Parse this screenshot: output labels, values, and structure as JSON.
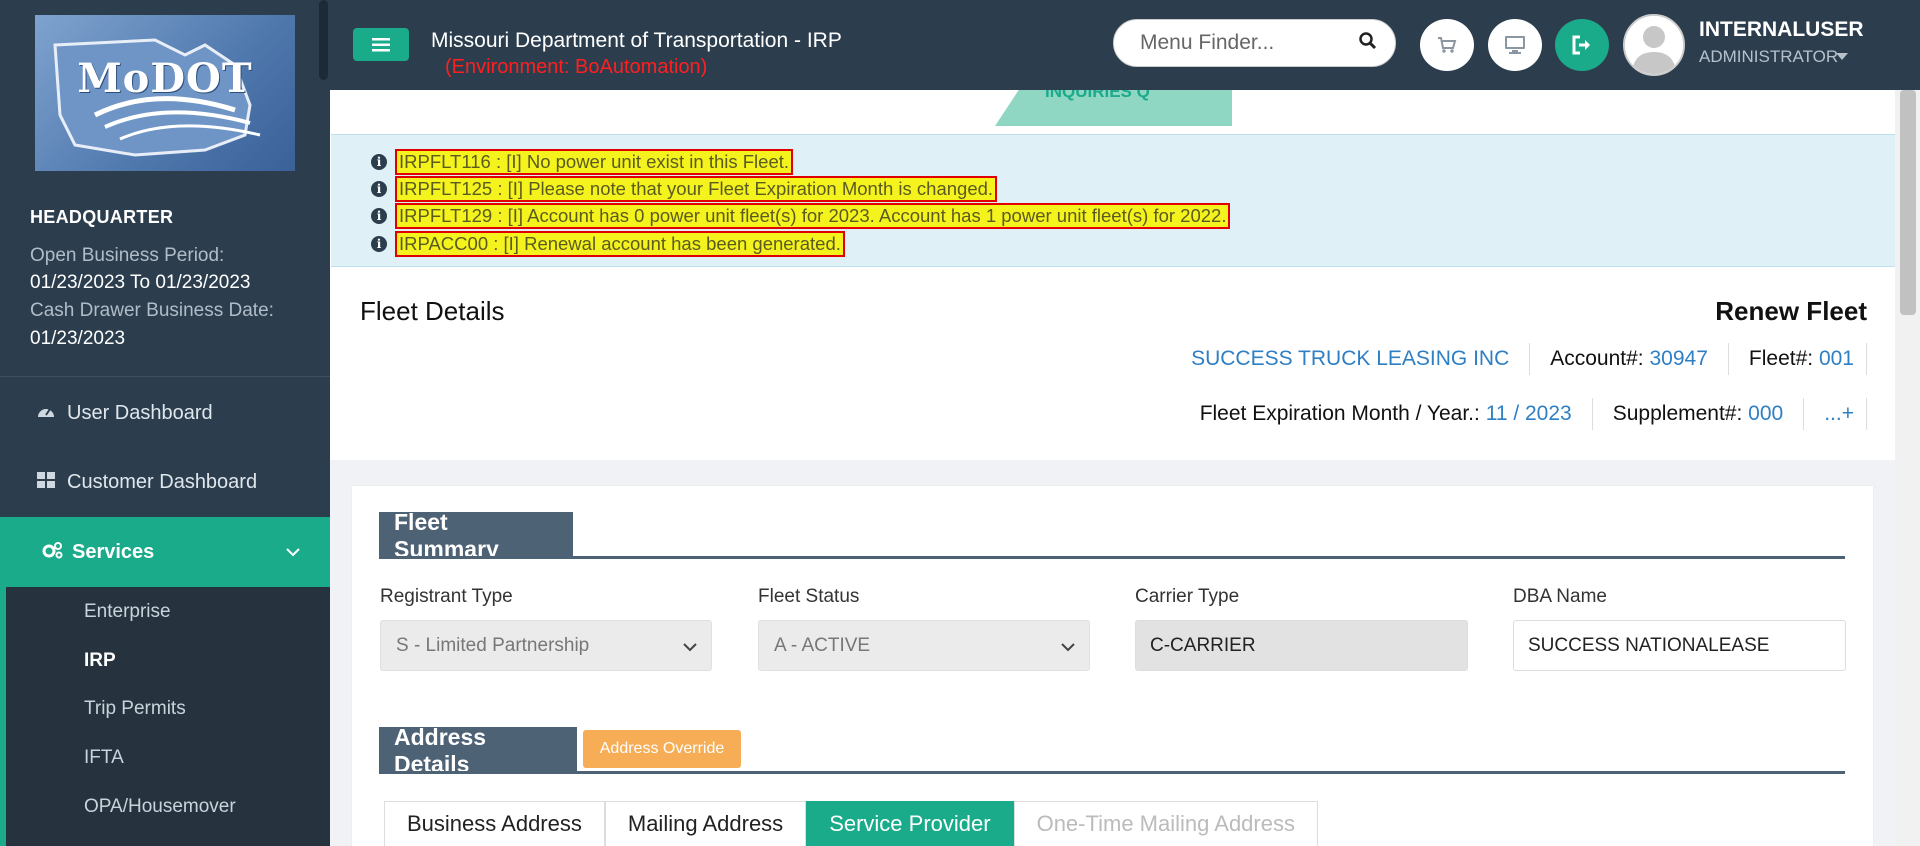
{
  "sidebar": {
    "logo_text": "MoDOT",
    "office": "HEADQUARTER",
    "open_business_period_label": "Open Business Period:",
    "open_business_period_value": "01/23/2023 To 01/23/2023",
    "cash_drawer_label": "Cash Drawer Business Date:",
    "cash_drawer_value": "01/23/2023",
    "nav": [
      {
        "label": "User Dashboard",
        "icon": "dashboard-icon"
      },
      {
        "label": "Customer Dashboard",
        "icon": "grid-icon"
      },
      {
        "label": "Services",
        "icon": "gears-icon",
        "active": true
      }
    ],
    "sub_items": [
      "Enterprise",
      "IRP",
      "Trip Permits",
      "IFTA",
      "OPA/Housemover"
    ],
    "current_sub_item": "IRP"
  },
  "header": {
    "title": "Missouri Department of Transportation - IRP",
    "environment": "(Environment: BoAutomation)",
    "menu_finder_placeholder": "Menu Finder...",
    "user_name": "INTERNALUSER",
    "user_role": "ADMINISTRATOR",
    "buttons": [
      "cart-icon",
      "desktop-icon",
      "logout-icon"
    ]
  },
  "inquiries_tab": "INQUIRIES Q",
  "messages": [
    "IRPFLT116 : [I] No power unit exist in this Fleet.",
    "IRPFLT125 : [I] Please note that your Fleet Expiration Month is changed.",
    "IRPFLT129 : [I] Account has 0 power unit fleet(s) for 2023. Account has 1 power unit fleet(s) for 2022.",
    "IRPACC00 : [I] Renewal account has been generated."
  ],
  "fleet": {
    "title": "Fleet Details",
    "action": "Renew Fleet",
    "company": "SUCCESS TRUCK LEASING INC",
    "account_label": "Account#:",
    "account_value": "30947",
    "fleet_label": "Fleet#:",
    "fleet_value": "001",
    "expiration_label": "Fleet Expiration Month / Year.:",
    "expiration_value": "11 / 2023",
    "supplement_label": "Supplement#:",
    "supplement_value": "000",
    "more": "...+"
  },
  "fleet_summary": {
    "heading": "Fleet Summary",
    "registrant_type_label": "Registrant Type",
    "registrant_type_value": "S - Limited Partnership",
    "fleet_status_label": "Fleet Status",
    "fleet_status_value": "A - ACTIVE",
    "carrier_type_label": "Carrier Type",
    "carrier_type_value": "C-CARRIER",
    "dba_name_label": "DBA Name",
    "dba_name_value": "SUCCESS NATIONALEASE"
  },
  "address_details": {
    "heading": "Address Details",
    "override_button": "Address Override",
    "tabs": [
      "Business Address",
      "Mailing Address",
      "Service Provider",
      "One-Time Mailing Address"
    ],
    "active_tab": "Service Provider"
  },
  "colors": {
    "accent": "#1aab8a",
    "nav_bg": "#2c3e4e",
    "link": "#2e7fc4",
    "warning": "#f6ad55",
    "highlight": "#f5f31e",
    "error_border": "#e00000"
  }
}
